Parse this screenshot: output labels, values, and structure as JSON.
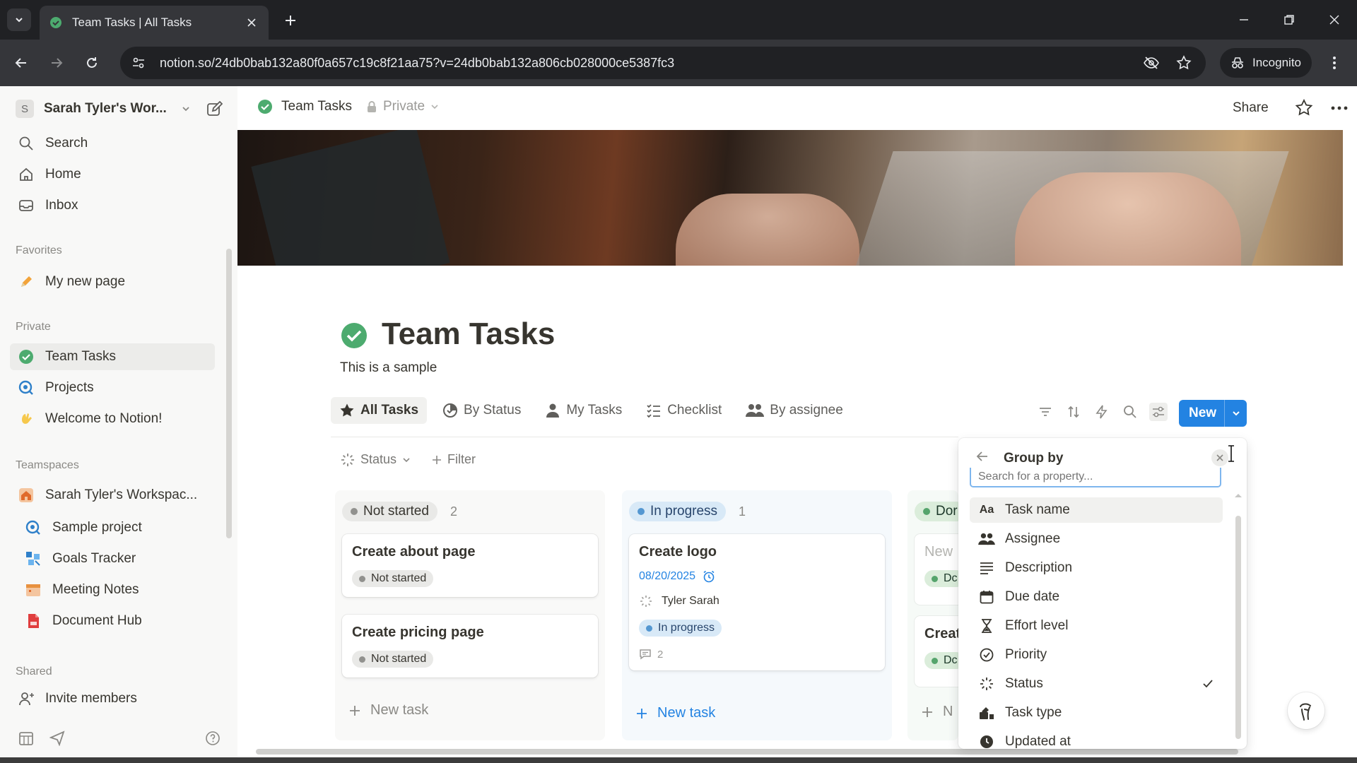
{
  "browser": {
    "tab_title": "Team Tasks | All Tasks",
    "url": "notion.so/24db0bab132a80f0a657c19c8f21aa75?v=24db0bab132a806cb028000ce5387fc3",
    "incognito_label": "Incognito"
  },
  "sidebar": {
    "workspace_initial": "S",
    "workspace_name": "Sarah Tyler's Wor...",
    "top_items": [
      {
        "label": "Search",
        "icon": "search-icon"
      },
      {
        "label": "Home",
        "icon": "home-icon"
      },
      {
        "label": "Inbox",
        "icon": "inbox-icon"
      }
    ],
    "favorites_heading": "Favorites",
    "favorites": [
      {
        "label": "My new page",
        "icon": "pencil-icon"
      }
    ],
    "private_heading": "Private",
    "private": [
      {
        "label": "Team Tasks",
        "icon": "check-circle-icon"
      },
      {
        "label": "Projects",
        "icon": "projects-icon"
      },
      {
        "label": "Welcome to Notion!",
        "icon": "wave-icon"
      }
    ],
    "teamspaces_heading": "Teamspaces",
    "teamspace": {
      "label": "Sarah Tyler's Workspac...",
      "icon": "house-icon"
    },
    "teamspace_pages": [
      {
        "label": "Sample project",
        "icon": "target-icon"
      },
      {
        "label": "Goals Tracker",
        "icon": "goals-icon"
      },
      {
        "label": "Meeting Notes",
        "icon": "calendar-icon"
      },
      {
        "label": "Document Hub",
        "icon": "document-icon"
      }
    ],
    "shared_heading": "Shared",
    "invite_label": "Invite members"
  },
  "topbar": {
    "title": "Team Tasks",
    "privacy": "Private",
    "share_label": "Share"
  },
  "page": {
    "title": "Team Tasks",
    "description": "This is a sample"
  },
  "views": [
    {
      "label": "All Tasks",
      "icon": "star-icon"
    },
    {
      "label": "By Status",
      "icon": "status-circle-icon"
    },
    {
      "label": "My Tasks",
      "icon": "person-icon"
    },
    {
      "label": "Checklist",
      "icon": "checklist-icon"
    },
    {
      "label": "By assignee",
      "icon": "people-icon"
    }
  ],
  "toolbar": {
    "new_label": "New"
  },
  "filters": {
    "status_label": "Status",
    "filter_label": "Filter"
  },
  "board": {
    "columns": [
      {
        "status": "Not started",
        "count": "2",
        "cards": [
          {
            "title": "Create about page",
            "status": "Not started"
          },
          {
            "title": "Create pricing page",
            "status": "Not started"
          }
        ],
        "new_label": "New task"
      },
      {
        "status": "In progress",
        "count": "1",
        "cards": [
          {
            "title": "Create logo",
            "date": "08/20/2025",
            "assignee": "Tyler Sarah",
            "status": "In progress",
            "comments": "2"
          }
        ],
        "new_label": "New task"
      },
      {
        "status": "Dor",
        "card_titles": [
          "New",
          "Creat"
        ],
        "card_status": "Dc",
        "new_label": "N"
      }
    ]
  },
  "group_by": {
    "title": "Group by",
    "search_placeholder": "Search for a property...",
    "items": [
      {
        "label": "Task name",
        "icon": "Aa",
        "checked": false
      },
      {
        "label": "Assignee",
        "icon": "people-icon",
        "checked": false
      },
      {
        "label": "Description",
        "icon": "text-lines-icon",
        "checked": false
      },
      {
        "label": "Due date",
        "icon": "calendar-icon",
        "checked": false
      },
      {
        "label": "Effort level",
        "icon": "hourglass-icon",
        "checked": false
      },
      {
        "label": "Priority",
        "icon": "priority-icon",
        "checked": false
      },
      {
        "label": "Status",
        "icon": "status-icon",
        "checked": true
      },
      {
        "label": "Task type",
        "icon": "task-type-icon",
        "checked": false
      },
      {
        "label": "Updated at",
        "icon": "clock-icon",
        "checked": false
      }
    ]
  },
  "colors": {
    "accent": "#2383e2",
    "not_started": "#91918e",
    "in_progress": "#5497d1",
    "done": "#55a46c"
  }
}
